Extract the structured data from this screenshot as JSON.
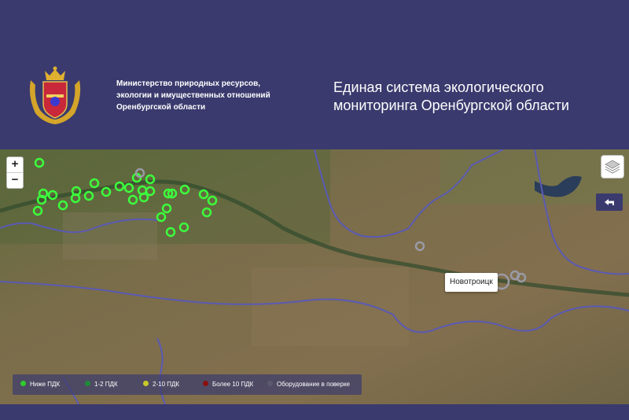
{
  "header": {
    "ministry_lines": [
      "Министерство природных ресурсов,",
      "экологии и имущественных отношений",
      "Оренбургской области"
    ],
    "title_lines": [
      "Единая система экологического",
      "мониторинга Оренбургской области"
    ]
  },
  "map": {
    "zoom_in_label": "+",
    "zoom_out_label": "−",
    "popup_label": "Новотроицк",
    "legend": [
      {
        "label": "Ниже ПДК",
        "color": "#2ecc2e"
      },
      {
        "label": "1-2 ПДК",
        "color": "#1e8a3a"
      },
      {
        "label": "2-10 ПДК",
        "color": "#c9c92a"
      },
      {
        "label": "Более 10 ПДК",
        "color": "#8a1010"
      },
      {
        "label": "Оборудование в поверке",
        "color": "#5a5a6e"
      }
    ],
    "colors": {
      "header_bg": "#3a3a6e",
      "marker_green": "#3cff3c",
      "marker_gray": "#9a9aa6",
      "border_line": "#5a5ab4"
    }
  }
}
